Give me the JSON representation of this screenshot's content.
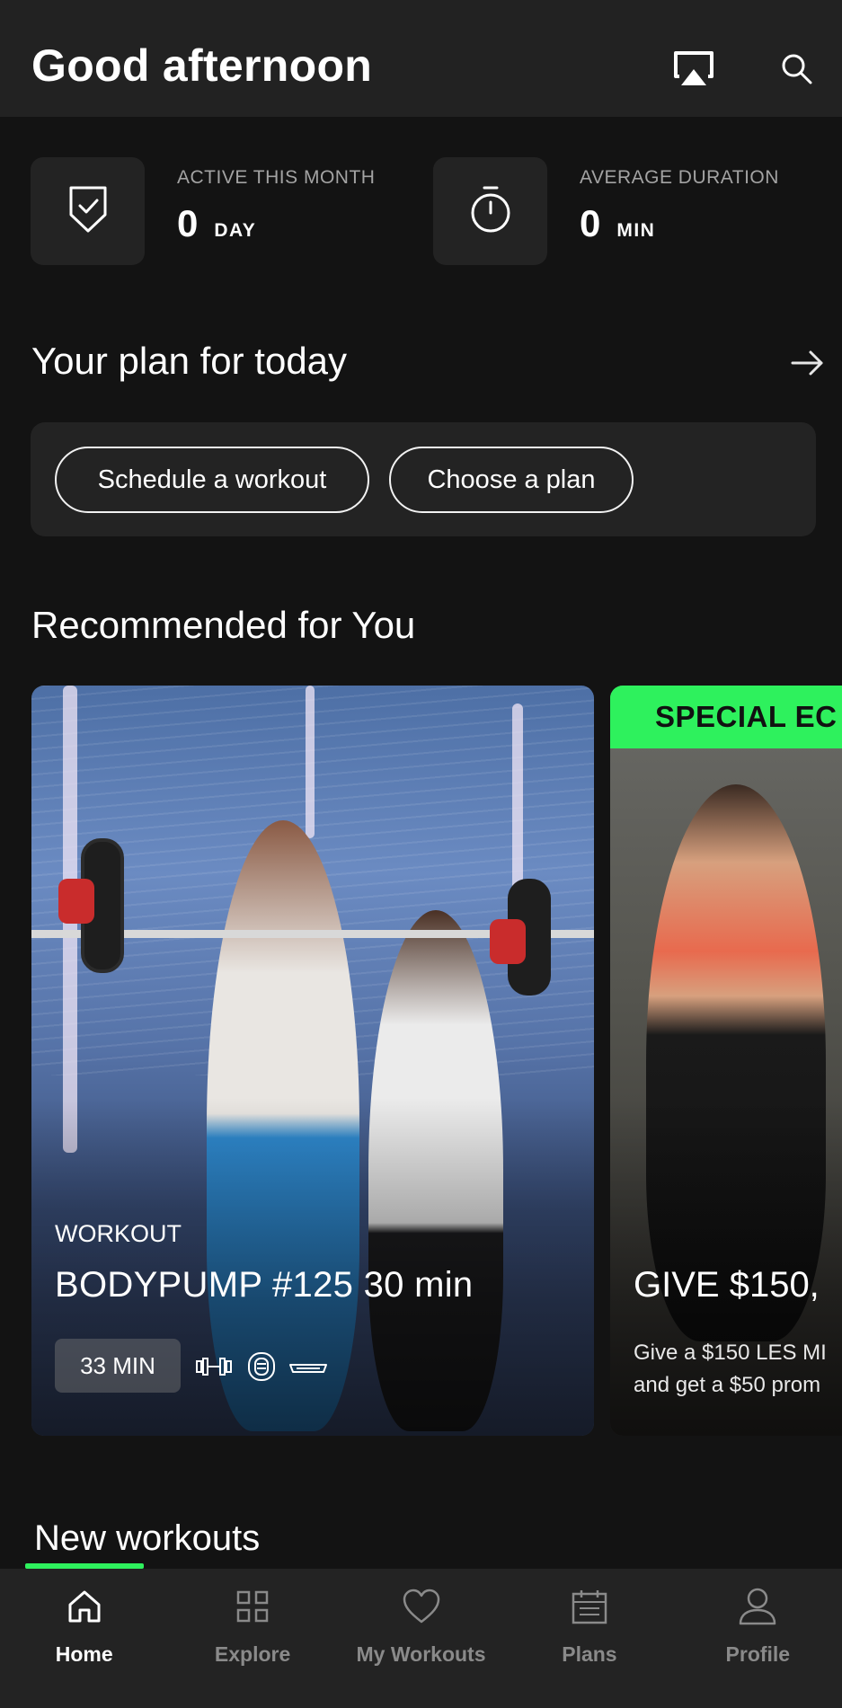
{
  "header": {
    "greeting": "Good afternoon",
    "icons": [
      "airplay-icon",
      "search-icon"
    ]
  },
  "stats": [
    {
      "label": "ACTIVE THIS MONTH",
      "value": "0",
      "unit": "DAY",
      "icon": "shield-check-icon"
    },
    {
      "label": "AVERAGE DURATION",
      "value": "0",
      "unit": "MIN",
      "icon": "stopwatch-icon"
    }
  ],
  "plan": {
    "title": "Your plan for today",
    "schedule_label": "Schedule a workout",
    "choose_label": "Choose a plan"
  },
  "recommended": {
    "title": "Recommended for You",
    "cards": [
      {
        "type": "WORKOUT",
        "title": "BODYPUMP #125 30 min",
        "duration": "33 MIN",
        "equipment": [
          "dumbbell-icon",
          "weight-plate-icon",
          "step-icon"
        ]
      },
      {
        "banner": "SPECIAL EC",
        "title": "GIVE $150,",
        "desc_line1": "Give a $150 LES MI",
        "desc_line2": "and get a $50 prom"
      }
    ]
  },
  "new_workouts": {
    "title": "New workouts"
  },
  "nav": {
    "items": [
      {
        "label": "Home",
        "icon": "home-icon"
      },
      {
        "label": "Explore",
        "icon": "grid-icon"
      },
      {
        "label": "My Workouts",
        "icon": "heart-icon"
      },
      {
        "label": "Plans",
        "icon": "calendar-icon"
      },
      {
        "label": "Profile",
        "icon": "person-icon"
      }
    ],
    "active": "Home"
  },
  "colors": {
    "accent": "#2ef15d",
    "background": "#131313",
    "surface": "#232323"
  }
}
